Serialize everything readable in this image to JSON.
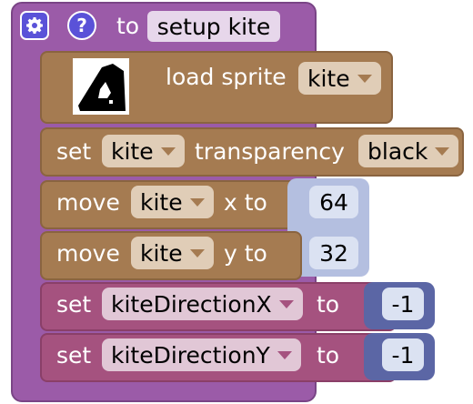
{
  "header": {
    "settings_icon": "gear-icon",
    "help_icon": "question-icon",
    "help_glyph": "?",
    "to_label": "to",
    "procedure_name": "setup kite"
  },
  "blocks": {
    "load_sprite": {
      "label": "load sprite",
      "value": "kite",
      "thumbnail": "kite-sprite"
    },
    "set_transparency": {
      "set": "set",
      "sprite": "kite",
      "label": "transparency",
      "value": "black"
    },
    "move_x": {
      "move": "move",
      "sprite": "kite",
      "label": "x to",
      "value": "64"
    },
    "move_y": {
      "move": "move",
      "sprite": "kite",
      "label": "y to",
      "value": "32"
    },
    "set_dir_x": {
      "set": "set",
      "variable": "kiteDirectionX",
      "to": "to",
      "value": "-1"
    },
    "set_dir_y": {
      "set": "set",
      "variable": "kiteDirectionY",
      "to": "to",
      "value": "-1"
    }
  },
  "colors": {
    "procedure": "#9b5ba8",
    "sprite_blocks": "#a57b51",
    "variable_blocks": "#a5527f",
    "math_blocks": "#5b66a5",
    "value_slot": "#b4bfe0"
  }
}
